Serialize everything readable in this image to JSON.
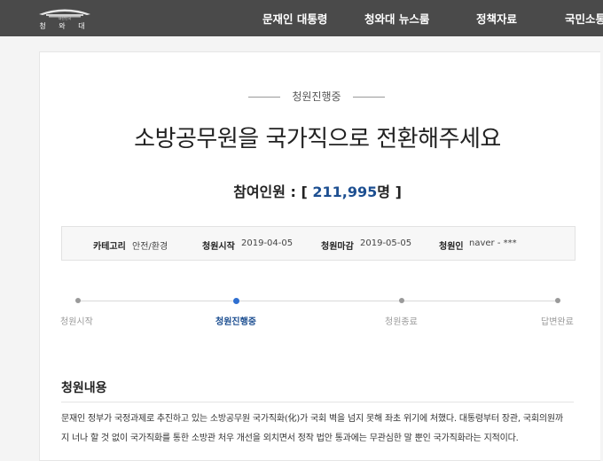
{
  "header": {
    "logo_subtitle": "대한민국",
    "logo_title": "청 와 대",
    "nav": [
      "문재인 대통령",
      "청와대 뉴스룸",
      "정책자료",
      "국민소통"
    ]
  },
  "petition": {
    "status": "청원진행중",
    "title": "소방공무원을 국가직으로 전환해주세요",
    "participants_label": "참여인원 : [",
    "participants_count": "211,995",
    "participants_suffix": "명 ]",
    "info": {
      "category_label": "카테고리",
      "category_value": "안전/환경",
      "start_label": "청원시작",
      "start_value": "2019-04-05",
      "end_label": "청원마감",
      "end_value": "2019-05-05",
      "author_label": "청원인",
      "author_value": "naver - ***"
    },
    "steps": [
      "청원시작",
      "청원진행중",
      "청원종료",
      "답변완료"
    ],
    "current_step": "청원진행중",
    "content_heading": "청원내용",
    "content_lines": [
      "문재인 정부가 국정과제로 추진하고 있는 소방공무원 국가직화(化)가 국회 벽을 넘지 못해 좌초 위기에 처했다. 대통령부터 장관, 국회의원까",
      "지 너나 할 것 없이 국가직화를 통한 소방관 처우 개선을 외치면서 정작 법안 통과에는 무관심한 말 뿐인 국가직화라는 지적이다."
    ]
  },
  "colors": {
    "header_bg": "#4a4a4a",
    "accent": "#1d4f91",
    "active_dot": "#2f6fd0"
  }
}
